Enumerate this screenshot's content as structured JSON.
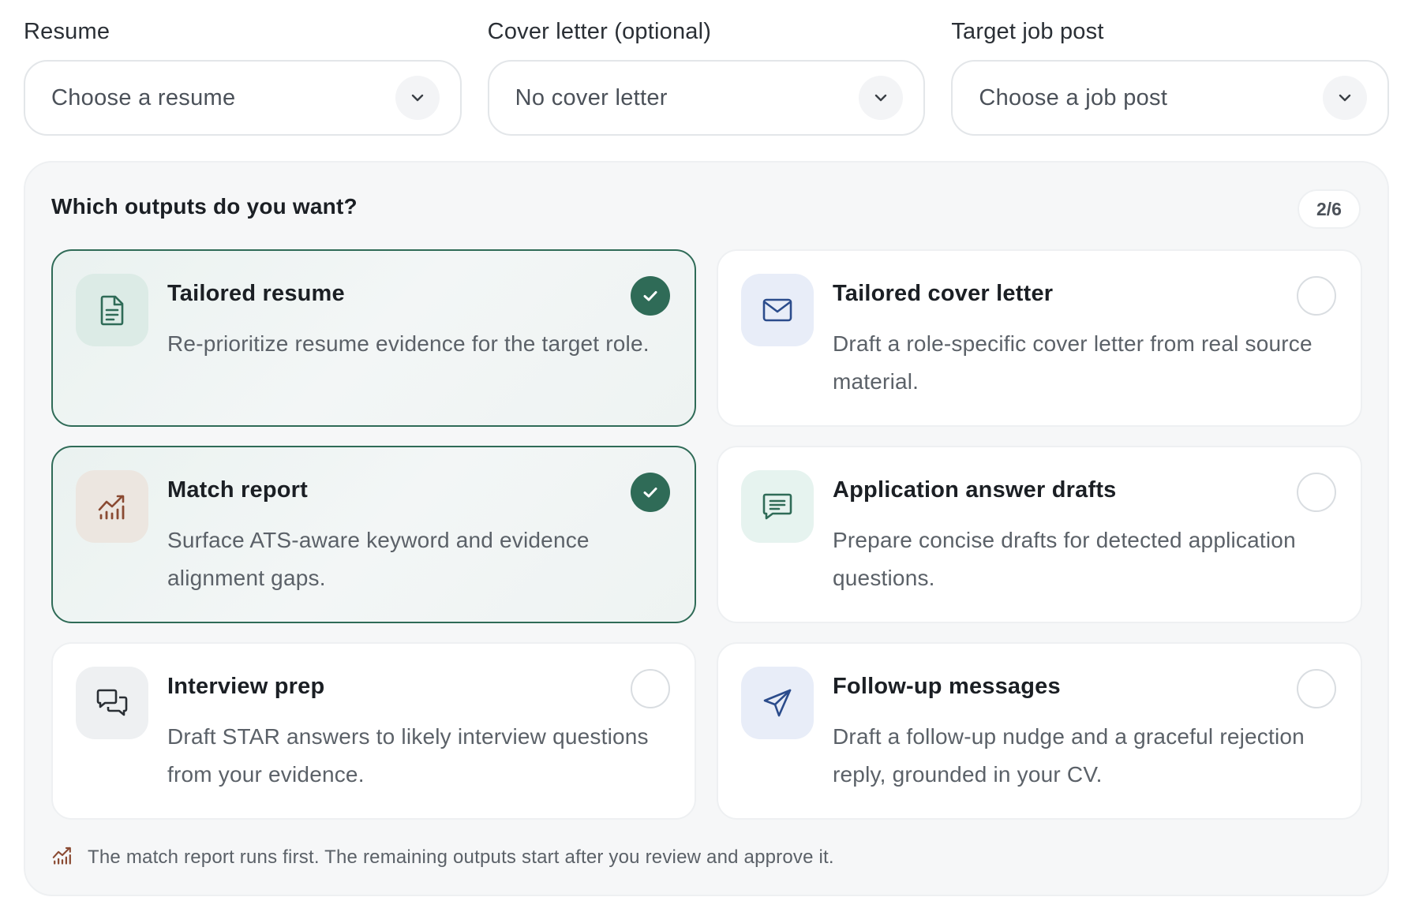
{
  "selectors": [
    {
      "label": "Resume",
      "value": "Choose a resume"
    },
    {
      "label": "Cover letter (optional)",
      "value": "No cover letter"
    },
    {
      "label": "Target job post",
      "value": "Choose a job post"
    }
  ],
  "outputs": {
    "title": "Which outputs do you want?",
    "counter": "2/6",
    "cards": [
      {
        "title": "Tailored resume",
        "description": "Re-prioritize resume evidence for the target role.",
        "selected": true,
        "icon": "document-icon"
      },
      {
        "title": "Tailored cover letter",
        "description": "Draft a role-specific cover letter from real source material.",
        "selected": false,
        "icon": "envelope-icon"
      },
      {
        "title": "Match report",
        "description": "Surface ATS-aware keyword and evidence alignment gaps.",
        "selected": true,
        "icon": "chart-icon"
      },
      {
        "title": "Application answer drafts",
        "description": "Prepare concise drafts for detected application questions.",
        "selected": false,
        "icon": "list-message-icon"
      },
      {
        "title": "Interview prep",
        "description": "Draft STAR answers to likely interview questions from your evidence.",
        "selected": false,
        "icon": "chat-bubbles-icon"
      },
      {
        "title": "Follow-up messages",
        "description": "Draft a follow-up nudge and a graceful rejection reply, grounded in your CV.",
        "selected": false,
        "icon": "send-icon"
      }
    ],
    "footnote": "The match report runs first. The remaining outputs start after you review and approve it."
  },
  "colors": {
    "accent": "#2f6b57",
    "chart_accent": "#8a4a32",
    "envelope_accent": "#2b4c8c"
  }
}
